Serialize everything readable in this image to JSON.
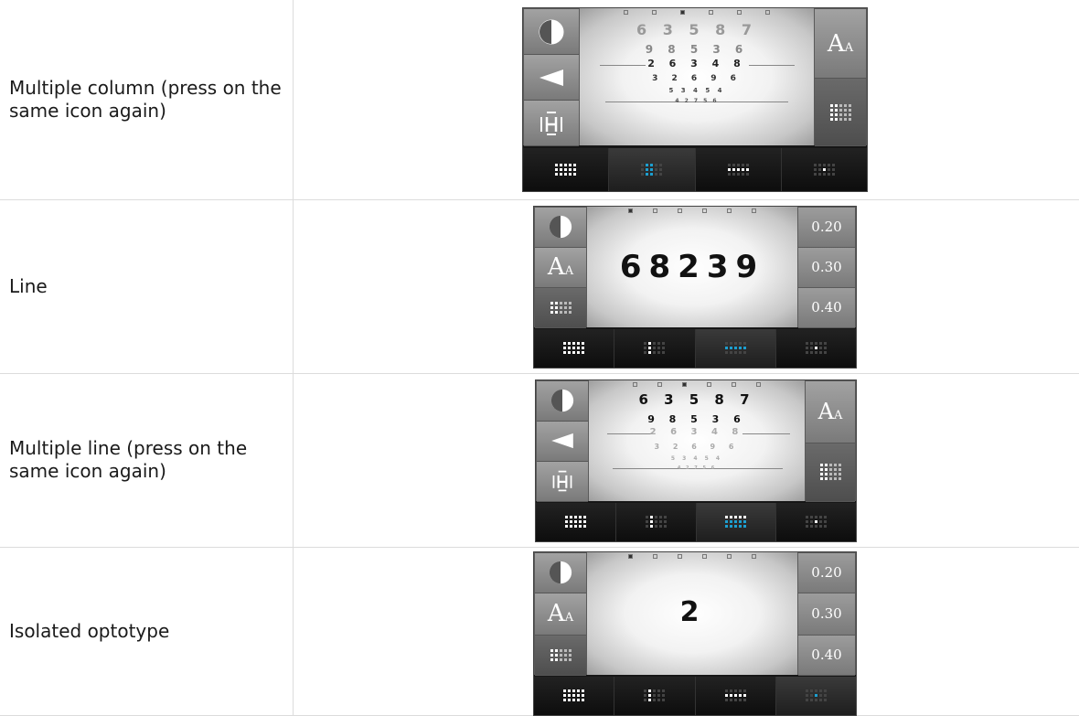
{
  "rows": [
    {
      "label": "Multiple column (press on the same icon again)"
    },
    {
      "label": "Line"
    },
    {
      "label": "Multiple line (press on the same icon again)"
    },
    {
      "label": "Isolated optotype"
    }
  ],
  "chart1": {
    "lines": [
      "6 3 5 8 7",
      "9 8 5 3 6",
      "2 6 3 4 8",
      "3 2 6 9 6",
      "5 3 4 5 4",
      "4 2 7 5 6"
    ],
    "aa": "A",
    "aa_small": "A"
  },
  "chart2": {
    "optotypes": "68239",
    "aa": "A",
    "aa_small": "A",
    "acuity": [
      "0.20",
      "0.30",
      "0.40"
    ]
  },
  "chart3": {
    "lines": [
      "6 3 5 8 7",
      "9 8 5 3 6",
      "2 6 3 4 8",
      "3 2 6 9 6",
      "5 3 4 5 4",
      "4 2 7 5 6"
    ],
    "aa": "A",
    "aa_small": "A"
  },
  "chart4": {
    "optotype": "2",
    "aa": "A",
    "aa_small": "A",
    "acuity": [
      "0.20",
      "0.30",
      "0.40"
    ]
  },
  "colors": {
    "accent": "#1c9fd0",
    "panel": "#8a8a8a",
    "tabbar": "#161616"
  },
  "icons": [
    "contrast-icon",
    "arrow-left-icon",
    "h-bar-icon",
    "font-size-icon",
    "grid-layout-icon"
  ]
}
